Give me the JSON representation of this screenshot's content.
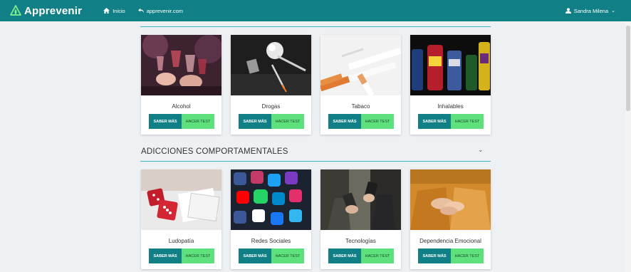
{
  "navbar": {
    "brand": "Apprevenir",
    "links": [
      {
        "label": "Inicio",
        "icon": "home-icon"
      },
      {
        "label": "apprevenir.com",
        "icon": "back-arrow-icon"
      }
    ],
    "user": {
      "name": "Sandra Milena",
      "icon": "user-icon"
    }
  },
  "sections": [
    {
      "title": "",
      "cards": [
        {
          "title": "Alcohol",
          "more_label": "SABER MÁS",
          "test_label": "HACER TEST"
        },
        {
          "title": "Drogas",
          "more_label": "SABER MÁS",
          "test_label": "HACER TEST"
        },
        {
          "title": "Tabaco",
          "more_label": "SABER MÁS",
          "test_label": "HACER TEST"
        },
        {
          "title": "Inhalables",
          "more_label": "SABER MÁS",
          "test_label": "HACER TEST"
        }
      ]
    },
    {
      "title": "ADICCIONES COMPORTAMENTALES",
      "cards": [
        {
          "title": "Ludopatía",
          "more_label": "SABER MÁS",
          "test_label": "HACER TEST"
        },
        {
          "title": "Redes Sociales",
          "more_label": "SABER MÁS",
          "test_label": "HACER TEST"
        },
        {
          "title": "Tecnologías",
          "more_label": "SABER MÁS",
          "test_label": "HACER TEST"
        },
        {
          "title": "Dependencia Emocional",
          "more_label": "SABER MÁS",
          "test_label": "HACER TEST"
        }
      ]
    }
  ],
  "colors": {
    "primary": "#117f86",
    "accent": "#5ee07c",
    "rule": "#36b9c0"
  }
}
